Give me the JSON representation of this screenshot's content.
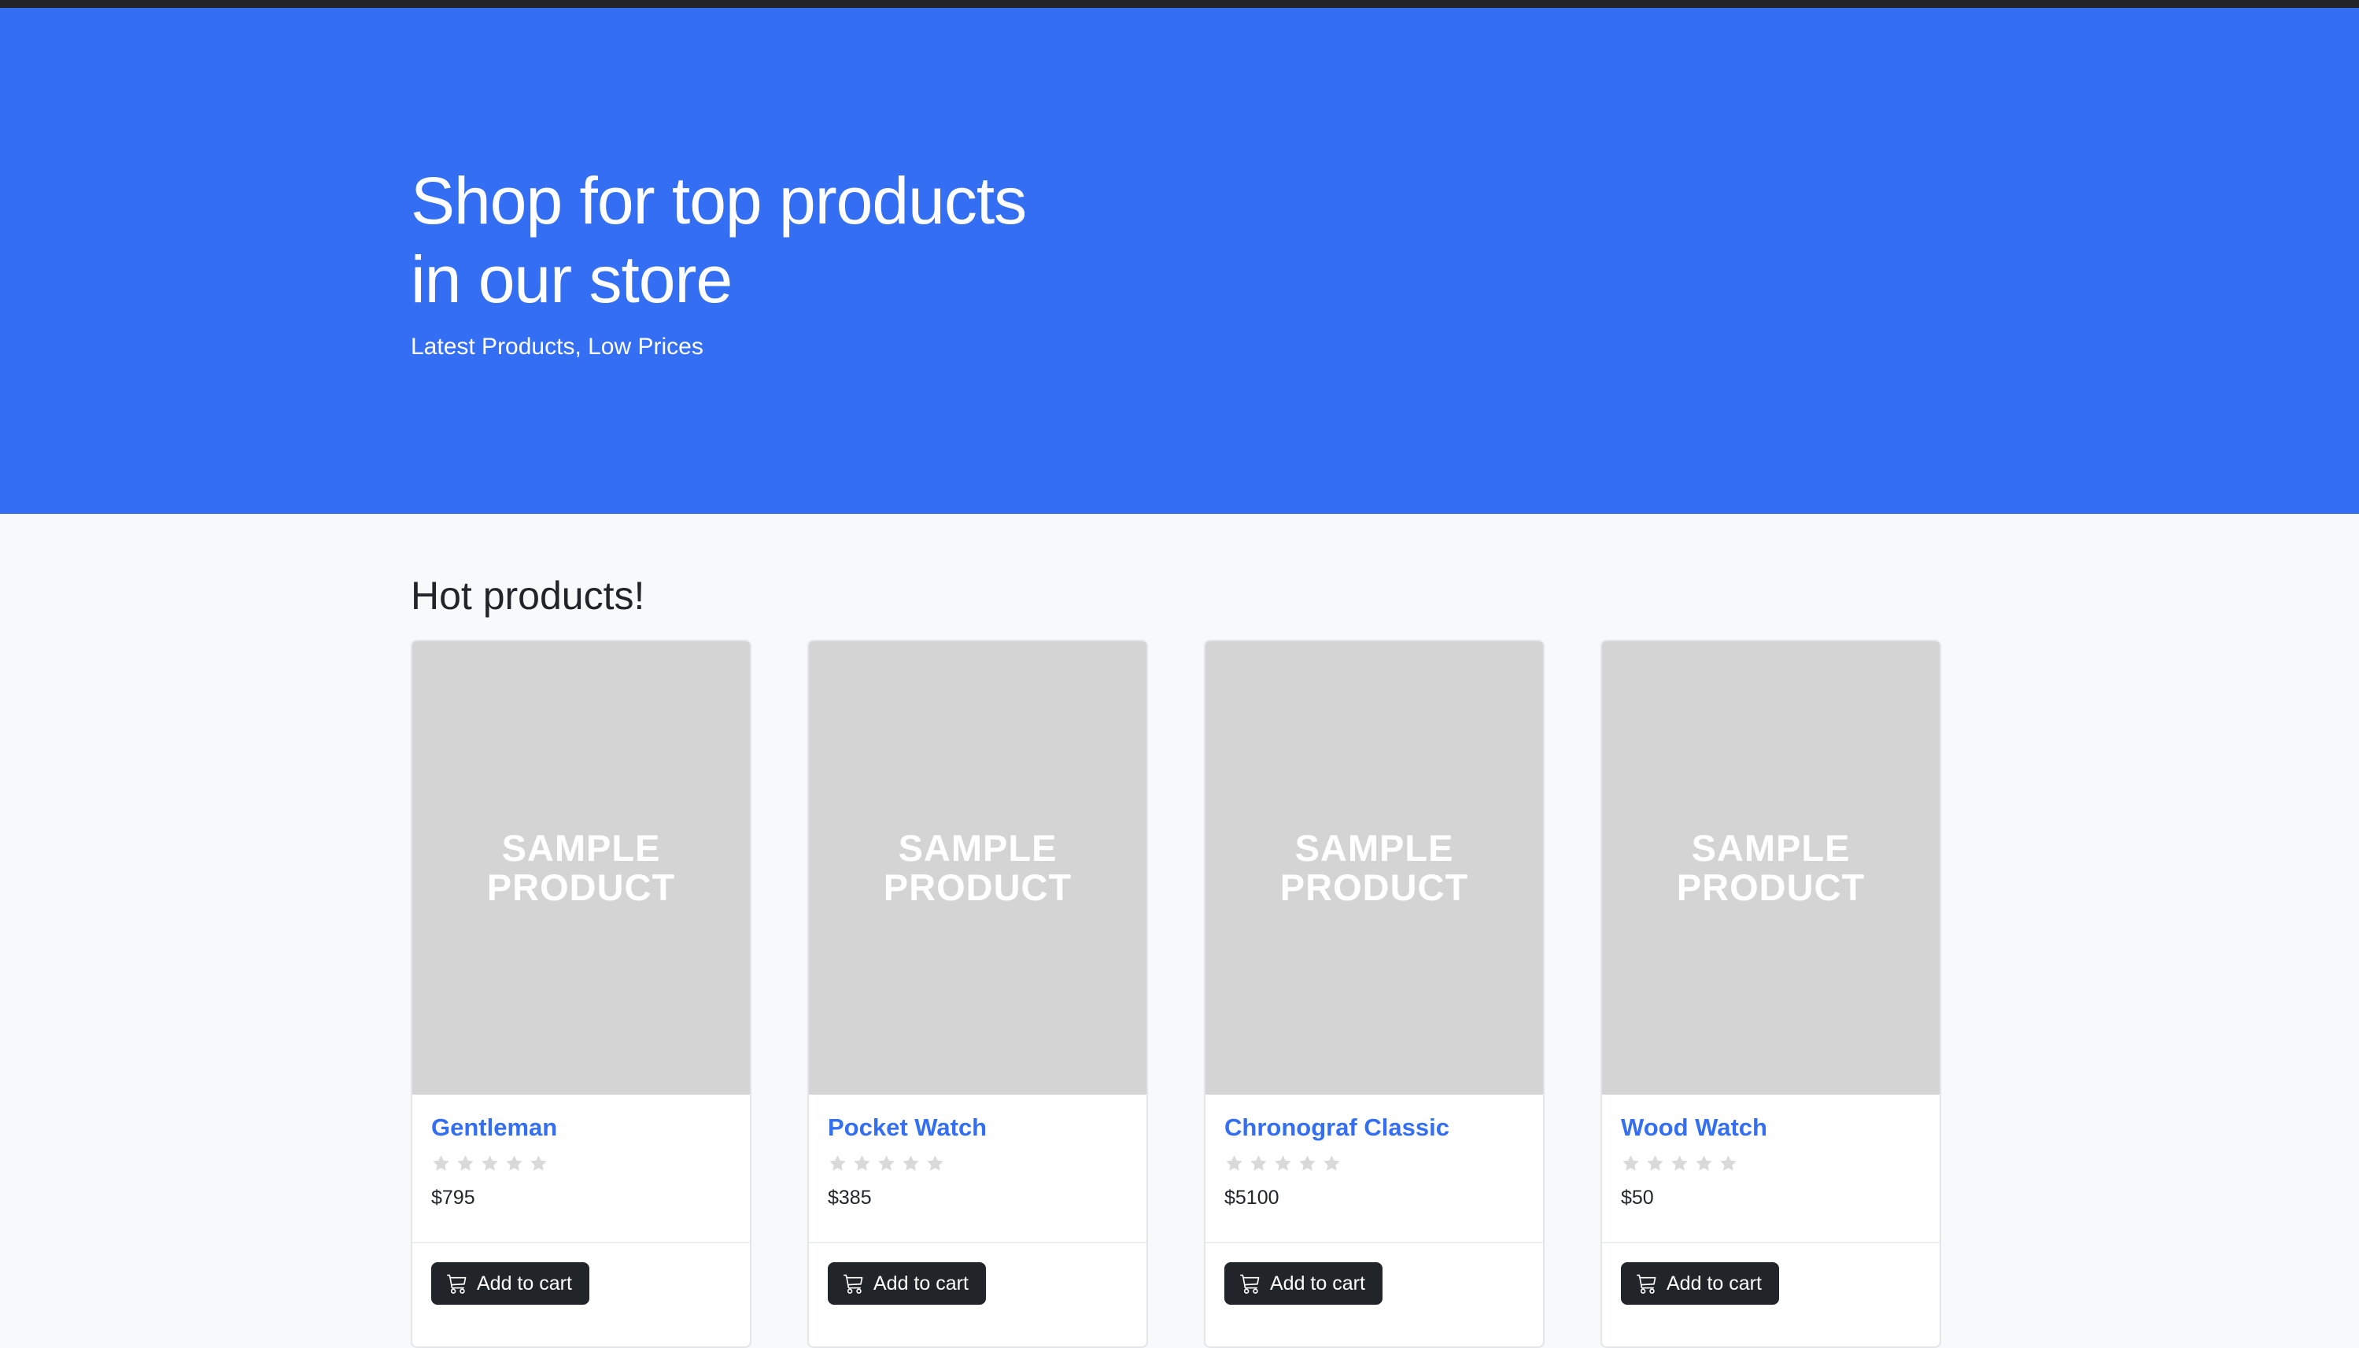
{
  "hero": {
    "title_line1": "Shop for top products",
    "title_line2": "in our store",
    "subtitle": "Latest Products, Low Prices",
    "background_color": "#336ef3"
  },
  "section": {
    "title": "Hot products!"
  },
  "products": [
    {
      "name": "Gentleman",
      "price": "$795",
      "rating": 0,
      "image_line1": "SAMPLE",
      "image_line2": "PRODUCT",
      "button_label": "Add to cart"
    },
    {
      "name": "Pocket Watch",
      "price": "$385",
      "rating": 0,
      "image_line1": "SAMPLE",
      "image_line2": "PRODUCT",
      "button_label": "Add to cart"
    },
    {
      "name": "Chronograf Classic",
      "price": "$5100",
      "rating": 0,
      "image_line1": "SAMPLE",
      "image_line2": "PRODUCT",
      "button_label": "Add to cart"
    },
    {
      "name": "Wood Watch",
      "price": "$50",
      "rating": 0,
      "image_line1": "SAMPLE",
      "image_line2": "PRODUCT",
      "button_label": "Add to cart"
    }
  ],
  "icons": {
    "star": "star-icon",
    "cart": "cart-icon"
  },
  "colors": {
    "accent": "#336ef3",
    "star_empty": "#d9d9d9",
    "button": "#212529",
    "image_placeholder": "#d4d4d4"
  }
}
